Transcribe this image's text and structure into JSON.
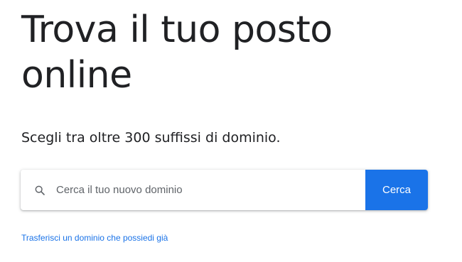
{
  "hero": {
    "title_line1": "Trova il tuo posto",
    "title_line2": "online",
    "subtitle": "Scegli tra oltre 300 suffissi di dominio."
  },
  "search": {
    "icon": "search-icon",
    "placeholder": "Cerca il tuo nuovo dominio",
    "value": "",
    "button_label": "Cerca"
  },
  "links": {
    "transfer": "Trasferisci un dominio che possiedi già"
  },
  "colors": {
    "accent": "#1a73e8",
    "text": "#202124",
    "placeholder": "#5f6368",
    "background": "#ffffff"
  }
}
